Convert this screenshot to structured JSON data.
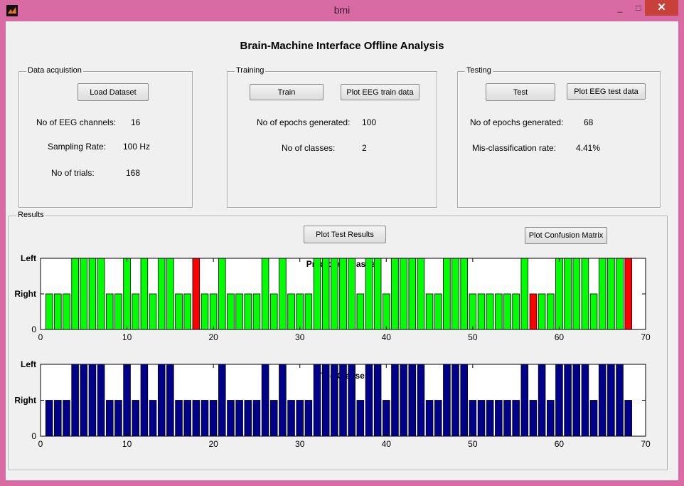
{
  "window": {
    "title": "bmi",
    "minimize_glyph": "_",
    "maximize_glyph": "□",
    "close_glyph": "✕"
  },
  "main_title": "Brain-Machine Interface Offline Analysis",
  "data_acq": {
    "legend": "Data acquistion",
    "load_button": "Load Dataset",
    "channels_label": "No of EEG channels:",
    "channels_value": "16",
    "rate_label": "Sampling Rate:",
    "rate_value": "100 Hz",
    "trials_label": "No of trials:",
    "trials_value": "168"
  },
  "training": {
    "legend": "Training",
    "train_button": "Train",
    "plot_button": "Plot EEG train data",
    "epochs_label": "No of epochs generated:",
    "epochs_value": "100",
    "classes_label": "No of classes:",
    "classes_value": "2"
  },
  "testing": {
    "legend": "Testing",
    "test_button": "Test",
    "plot_button": "Plot EEG test data",
    "epochs_label": "No of epochs generated:",
    "epochs_value": "68",
    "misclass_label": "Mis-classification rate:",
    "misclass_value": "4.41%"
  },
  "results": {
    "legend": "Results",
    "plot_results_button": "Plot Test Results",
    "confusion_button": "Plot Confusion Matrix"
  },
  "chart_data": [
    {
      "type": "bar",
      "title": "Predicted Classes",
      "xlim": [
        0,
        70
      ],
      "ylim": [
        0,
        2
      ],
      "xticks": [
        0,
        10,
        20,
        30,
        40,
        50,
        60,
        70
      ],
      "yticks": [
        {
          "value": 0,
          "label": "0"
        },
        {
          "value": 1,
          "label": "Right"
        },
        {
          "value": 2,
          "label": "Left"
        }
      ],
      "x": [
        1,
        2,
        3,
        4,
        5,
        6,
        7,
        8,
        9,
        10,
        11,
        12,
        13,
        14,
        15,
        16,
        17,
        18,
        19,
        20,
        21,
        22,
        23,
        24,
        25,
        26,
        27,
        28,
        29,
        30,
        31,
        32,
        33,
        34,
        35,
        36,
        37,
        38,
        39,
        40,
        41,
        42,
        43,
        44,
        45,
        46,
        47,
        48,
        49,
        50,
        51,
        52,
        53,
        54,
        55,
        56,
        57,
        58,
        59,
        60,
        61,
        62,
        63,
        64,
        65,
        66,
        67,
        68
      ],
      "values": [
        1,
        1,
        1,
        2,
        2,
        2,
        2,
        1,
        1,
        2,
        1,
        2,
        1,
        2,
        2,
        1,
        1,
        2,
        1,
        1,
        2,
        1,
        1,
        1,
        1,
        2,
        1,
        2,
        1,
        1,
        1,
        2,
        2,
        2,
        2,
        2,
        1,
        2,
        2,
        1,
        2,
        2,
        2,
        2,
        1,
        1,
        2,
        2,
        2,
        1,
        1,
        1,
        1,
        1,
        1,
        2,
        1,
        1,
        1,
        2,
        2,
        2,
        2,
        1,
        2,
        2,
        2,
        2
      ],
      "colors": {
        "correct": "#00ff00",
        "incorrect": "#ff0000"
      },
      "incorrect_x": [
        18,
        57,
        68
      ]
    },
    {
      "type": "bar",
      "title": "True Classes",
      "xlim": [
        0,
        70
      ],
      "ylim": [
        0,
        2
      ],
      "xticks": [
        0,
        10,
        20,
        30,
        40,
        50,
        60,
        70
      ],
      "yticks": [
        {
          "value": 0,
          "label": "0"
        },
        {
          "value": 1,
          "label": "Right"
        },
        {
          "value": 2,
          "label": "Left"
        }
      ],
      "x": [
        1,
        2,
        3,
        4,
        5,
        6,
        7,
        8,
        9,
        10,
        11,
        12,
        13,
        14,
        15,
        16,
        17,
        18,
        19,
        20,
        21,
        22,
        23,
        24,
        25,
        26,
        27,
        28,
        29,
        30,
        31,
        32,
        33,
        34,
        35,
        36,
        37,
        38,
        39,
        40,
        41,
        42,
        43,
        44,
        45,
        46,
        47,
        48,
        49,
        50,
        51,
        52,
        53,
        54,
        55,
        56,
        57,
        58,
        59,
        60,
        61,
        62,
        63,
        64,
        65,
        66,
        67,
        68
      ],
      "values": [
        1,
        1,
        1,
        2,
        2,
        2,
        2,
        1,
        1,
        2,
        1,
        2,
        1,
        2,
        2,
        1,
        1,
        1,
        1,
        1,
        2,
        1,
        1,
        1,
        1,
        2,
        1,
        2,
        1,
        1,
        1,
        2,
        2,
        2,
        2,
        2,
        1,
        2,
        2,
        1,
        2,
        2,
        2,
        2,
        1,
        1,
        2,
        2,
        2,
        1,
        1,
        1,
        1,
        1,
        1,
        2,
        1,
        2,
        1,
        2,
        2,
        2,
        2,
        1,
        2,
        2,
        2,
        1
      ],
      "colors": {
        "bar": "#00008b"
      }
    }
  ]
}
